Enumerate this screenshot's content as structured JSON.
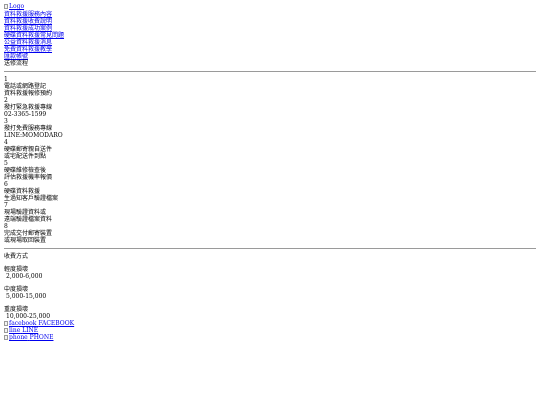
{
  "logo": {
    "alt": "Logo",
    "icon": "broken-image-icon"
  },
  "nav": {
    "links": [
      "資料救援服務內容",
      "資料救援收費說明",
      "資料救援成功案例",
      "硬碟資料救援常見問題",
      "公益資料救援消息",
      "免費資料救援教學",
      "匯款帳號"
    ],
    "current": "送修流程"
  },
  "steps": [
    {
      "number": "1",
      "title": "電話或網路登記",
      "desc": "資料救援報修預約"
    },
    {
      "number": "2",
      "title": "撥打緊急救援專線",
      "desc": "02-3365-1599"
    },
    {
      "number": "3",
      "title": "撥打免費服務專線",
      "desc": "LINE:MOMODARO"
    },
    {
      "number": "4",
      "title": "硬碟郵寄親自送件",
      "desc": "或宅配送件到點"
    },
    {
      "number": "5",
      "title": "硬碟維修檢查後",
      "desc": "評估救援機率報價"
    },
    {
      "number": "6",
      "title": "硬碟資料救援",
      "desc": "生過知客戶驗證檔案"
    },
    {
      "number": "7",
      "title": "現場驗證資料或",
      "desc": "遠端驗證檔案資料"
    },
    {
      "number": "8",
      "title": "完成交付郵寄裝置",
      "desc": "或現場取回裝置"
    }
  ],
  "pricing": {
    "title": "收費方式",
    "tiers": [
      {
        "label": "輕度損壞",
        "range": "2,000-6,000"
      },
      {
        "label": "中度損壞",
        "range": "5,000-15,000"
      },
      {
        "label": "重度損壞",
        "range": "10,000-25,000"
      }
    ]
  },
  "contacts": [
    {
      "alt": "facebook",
      "label": "FACEBOOK",
      "icon": "facebook-icon"
    },
    {
      "alt": "line",
      "label": "LINE",
      "icon": "line-icon"
    },
    {
      "alt": "phone",
      "label": "PHONE",
      "icon": "phone-icon"
    }
  ]
}
